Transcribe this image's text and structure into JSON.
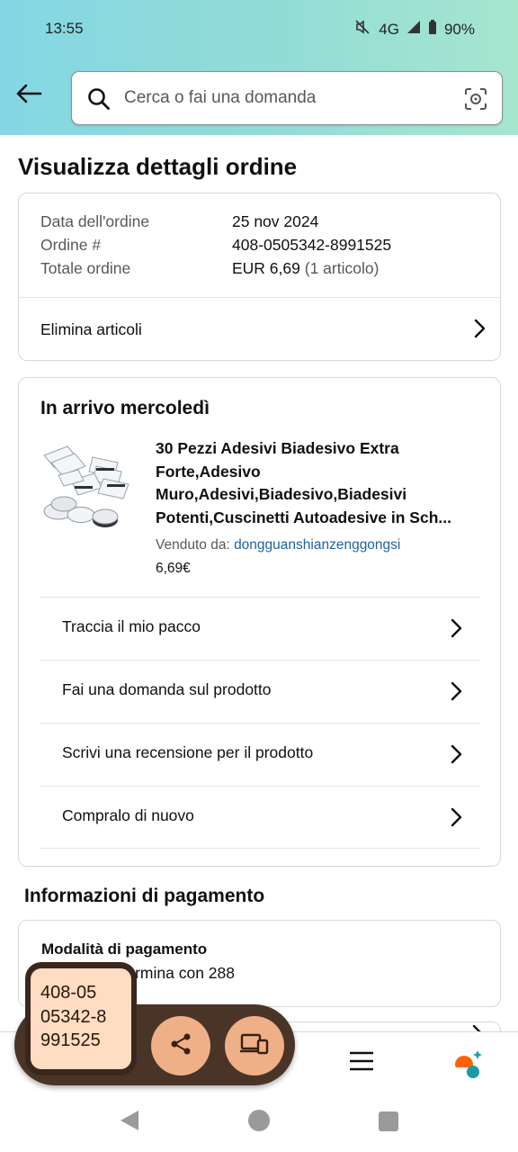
{
  "status_bar": {
    "time": "13:55",
    "network": "4G",
    "battery": "90%"
  },
  "search": {
    "placeholder": "Cerca o fai una domanda"
  },
  "page": {
    "title": "Visualizza dettagli ordine"
  },
  "order": {
    "rows": [
      {
        "label": "Data dell'ordine",
        "value": "25 nov 2024"
      },
      {
        "label": "Ordine #",
        "value": "408-0505342-8991525"
      },
      {
        "label": "Totale ordine",
        "value": "EUR 6,69",
        "value_extra": "(1 articolo)"
      }
    ],
    "delete_items_label": "Elimina articoli"
  },
  "shipment": {
    "arriving_label": "In arrivo mercoledì",
    "product": {
      "title_lines": [
        "30 Pezzi Adesivi Biadesivo Extra",
        "Forte,Adesivo",
        "Muro,Adesivi,Biadesivo,Biadesivi",
        "Potenti,Cuscinetti Autoadesive in Sch..."
      ],
      "sold_by_label": "Venduto da:",
      "seller": "dongguanshianzenggongsi",
      "price": "6,69€"
    },
    "actions": [
      "Traccia il mio pacco",
      "Fai una domanda sul prodotto",
      "Scrivi una recensione per il prodotto",
      "Compralo di nuovo"
    ]
  },
  "payment": {
    "section_title": "Informazioni di pagamento",
    "method_label": "Modalità di pagamento",
    "method_value": "skonto che termina con 288"
  },
  "overlay": {
    "copied_text_lines": [
      "408-05",
      "05342-8",
      "991525"
    ]
  },
  "icons": [
    "back-arrow-icon",
    "search-icon",
    "camera-lens-icon",
    "chevron-right-icon",
    "menu-icon",
    "rufus-assistant-icon",
    "share-icon",
    "devices-icon",
    "nav-back-icon",
    "nav-home-icon",
    "nav-recents-icon",
    "mute-icon",
    "signal-icon",
    "battery-icon"
  ],
  "colors": {
    "accent_link": "#2162a1",
    "header_gradient_start": "#84d7e4",
    "header_gradient_end": "#a6e6cf",
    "overlay_bg": "#4a3428",
    "overlay_button": "#efb088",
    "rufus_orange": "#ff6200",
    "rufus_teal": "#1d9aa8"
  }
}
